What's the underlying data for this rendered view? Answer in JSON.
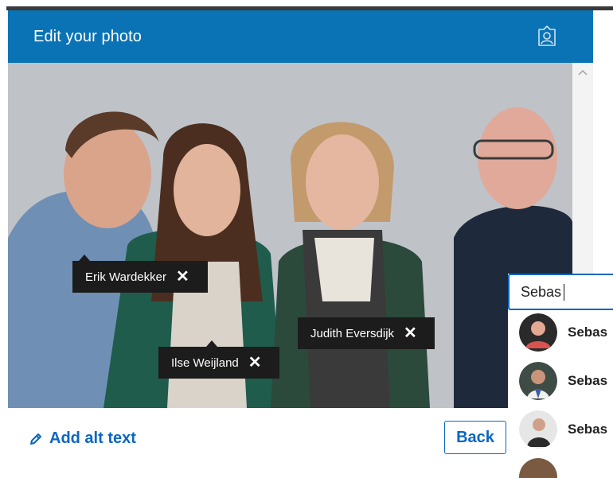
{
  "header": {
    "title": "Edit your photo",
    "icon": "person-tag-icon"
  },
  "tags": [
    {
      "name": "Erik Wardekker"
    },
    {
      "name": "Ilse Weijland"
    },
    {
      "name": "Judith Eversdijk"
    }
  ],
  "tag_close_symbol": "✕",
  "search": {
    "value": "Sebas",
    "results": [
      {
        "name": "Sebas"
      },
      {
        "name": "Sebas"
      },
      {
        "name": "Sebas"
      }
    ]
  },
  "footer": {
    "alt_text_label": "Add alt text",
    "back_label": "Back"
  },
  "colors": {
    "brand_blue": "#0a73b5",
    "link_blue": "#0a66c2",
    "tag_bg": "#1c1c1c",
    "photo_backdrop": "#bfc3c8"
  }
}
